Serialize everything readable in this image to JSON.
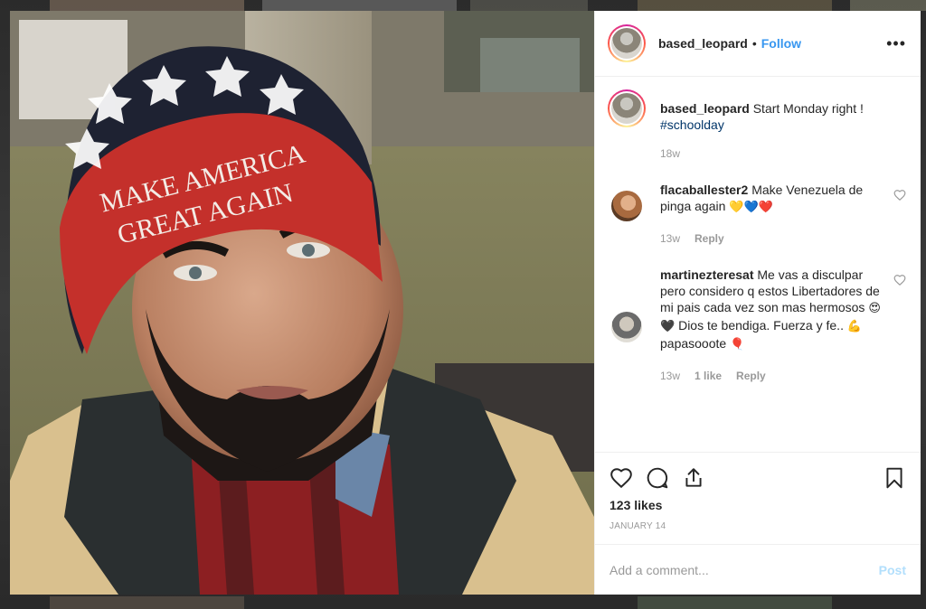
{
  "post": {
    "author": "based_leopard",
    "dot": "•",
    "follow_label": "Follow",
    "more_label": "•••",
    "caption": {
      "username": "based_leopard",
      "text": "Start Monday right !",
      "hashtag": "#schoolday",
      "time": "18w"
    },
    "photo_alt": "Selfie photo",
    "beanie_text_line1": "MAKE AMERICA",
    "beanie_text_line2": "GREAT AGAIN"
  },
  "comments": [
    {
      "username": "flacaballester2",
      "text": "Make Venezuela de pinga again",
      "emoji": "💛💙❤️",
      "time": "13w",
      "likes": "",
      "reply_label": "Reply",
      "avatar_color": "#a86a3f"
    },
    {
      "username": "martineztere­sat",
      "text": "Me vas a disculpar pero considero q estos Libertadores de mi pais cada vez son mas hermosos",
      "emoji_mid": "😍🖤",
      "text2": "Dios te bendiga. Fuerza y fe..",
      "emoji_end": "💪",
      "text3": "papasooote",
      "emoji_last": "🎈",
      "time": "13w",
      "likes": "1 like",
      "reply_label": "Reply",
      "avatar_color": "#6b6b6b"
    }
  ],
  "actions": {
    "likes_label": "123 likes",
    "date_label": "JANUARY 14"
  },
  "composer": {
    "placeholder": "Add a comment...",
    "post_label": "Post"
  },
  "colors": {
    "accent": "#3897f0",
    "hashtag": "#003569",
    "muted": "#999999",
    "post_disabled": "#b2dffc",
    "beanie_red": "#c4302b"
  }
}
